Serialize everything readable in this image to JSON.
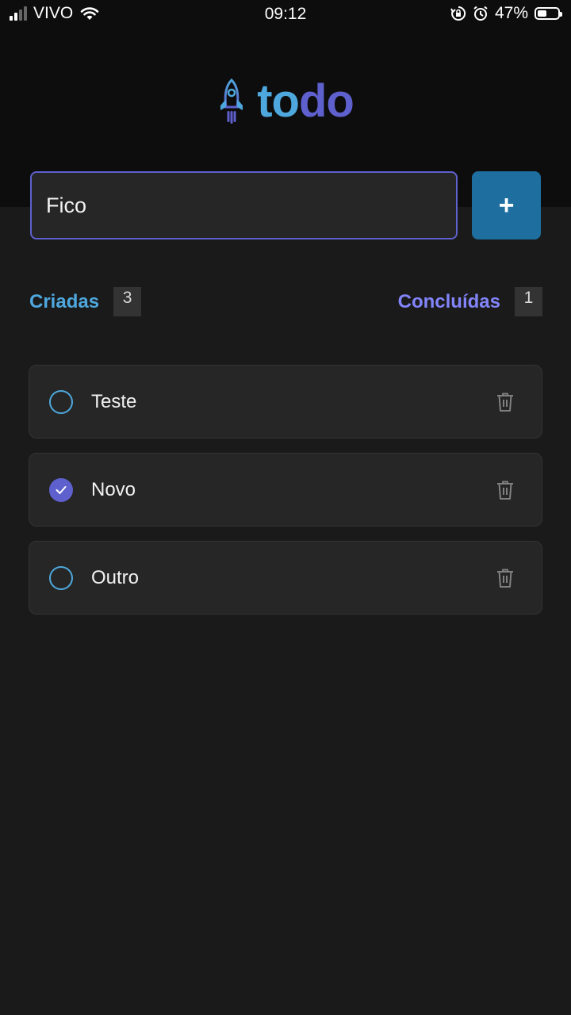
{
  "status_bar": {
    "carrier": "VIVO",
    "time": "09:12",
    "battery": "47%",
    "battery_level": 0.47
  },
  "logo": {
    "text_part1": "to",
    "text_part2": "do",
    "icon": "rocket-icon"
  },
  "new_task": {
    "value": "Fico",
    "add_label": "+"
  },
  "counters": {
    "created_label": "Criadas",
    "created_count": "3",
    "done_label": "Concluídas",
    "done_count": "1"
  },
  "tasks": [
    {
      "text": "Teste",
      "done": false
    },
    {
      "text": "Novo",
      "done": true
    },
    {
      "text": "Outro",
      "done": false
    }
  ],
  "colors": {
    "blue": "#4ea8de",
    "purple": "#5e60ce",
    "purple_light": "#8284fa",
    "button": "#1e6f9f"
  }
}
